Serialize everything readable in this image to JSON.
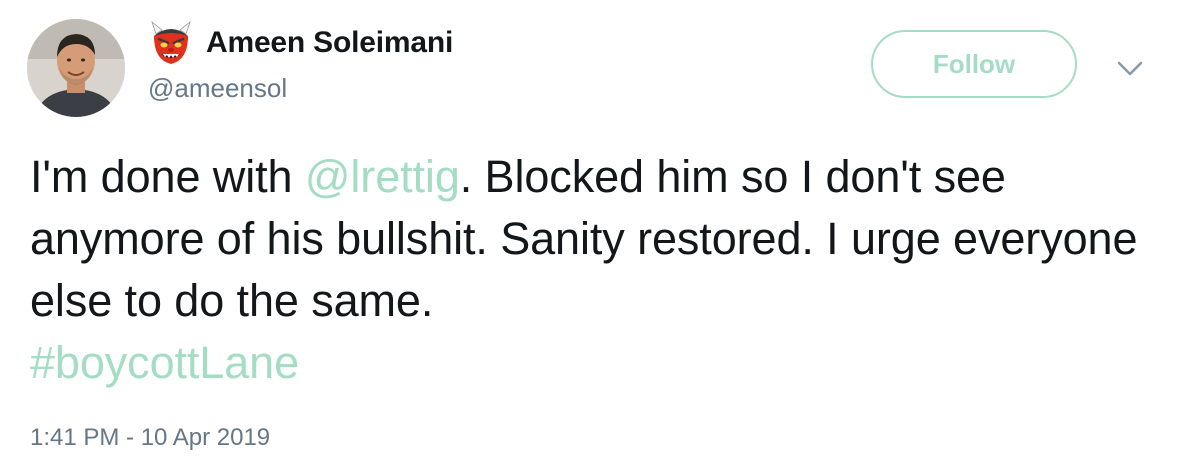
{
  "tweet": {
    "author": {
      "name": "Ameen Soleimani",
      "handle": "@ameensol",
      "name_emoji": "ogre-emoji-icon"
    },
    "follow_label": "Follow",
    "menu_icon": "chevron-down-icon",
    "text": {
      "part1": "I'm done with ",
      "mention": "@lrettig",
      "part2": ". Blocked him so I don't see anymore of his bullshit. Sanity restored. I urge everyone else to do the same.",
      "hashtag": "#boycottLane"
    },
    "timestamp": "1:41 PM - 10 Apr 2019"
  },
  "colors": {
    "accent": "#a5dcc4",
    "text": "#14171a",
    "secondary": "#657786"
  }
}
